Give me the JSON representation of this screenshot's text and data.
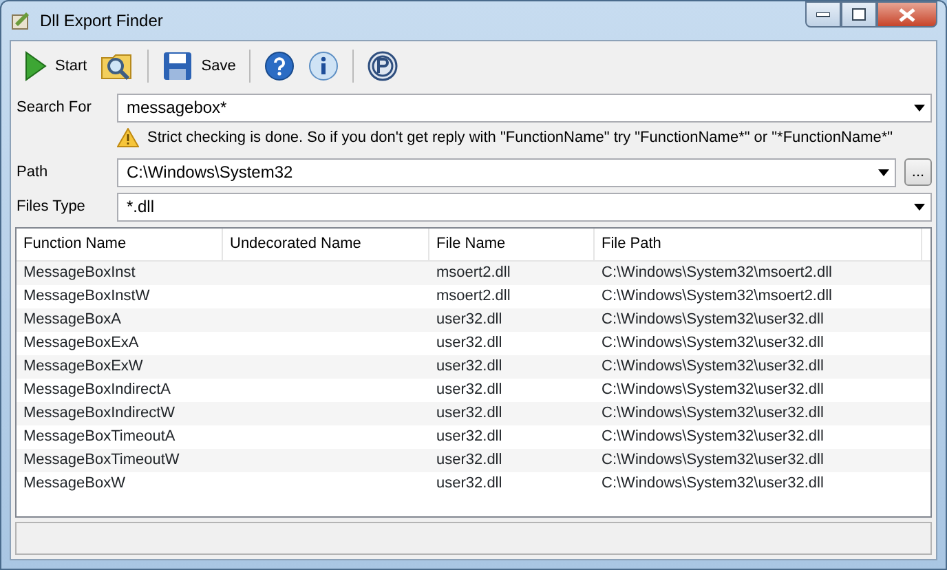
{
  "window": {
    "title": "Dll Export Finder"
  },
  "toolbar": [
    {
      "kind": "start",
      "label": "Start"
    },
    {
      "kind": "browse"
    },
    {
      "kind": "sep"
    },
    {
      "kind": "save",
      "label": "Save"
    },
    {
      "kind": "sep"
    },
    {
      "kind": "help"
    },
    {
      "kind": "info"
    },
    {
      "kind": "sep"
    },
    {
      "kind": "donate"
    }
  ],
  "search": {
    "label": "Search For",
    "value": "messagebox*"
  },
  "hint": "Strict checking is done. So if you don't get reply with \"FunctionName\" try \"FunctionName*\" or \"*FunctionName*\"",
  "path": {
    "label": "Path",
    "value": "C:\\Windows\\System32",
    "browse": "..."
  },
  "files_type": {
    "label": "Files Type",
    "value": "*.dll"
  },
  "table": {
    "columns": [
      "Function Name",
      "Undecorated Name",
      "File Name",
      "File Path"
    ],
    "rows": [
      [
        "MessageBoxInst",
        "",
        "msoert2.dll",
        "C:\\Windows\\System32\\msoert2.dll"
      ],
      [
        "MessageBoxInstW",
        "",
        "msoert2.dll",
        "C:\\Windows\\System32\\msoert2.dll"
      ],
      [
        "MessageBoxA",
        "",
        "user32.dll",
        "C:\\Windows\\System32\\user32.dll"
      ],
      [
        "MessageBoxExA",
        "",
        "user32.dll",
        "C:\\Windows\\System32\\user32.dll"
      ],
      [
        "MessageBoxExW",
        "",
        "user32.dll",
        "C:\\Windows\\System32\\user32.dll"
      ],
      [
        "MessageBoxIndirectA",
        "",
        "user32.dll",
        "C:\\Windows\\System32\\user32.dll"
      ],
      [
        "MessageBoxIndirectW",
        "",
        "user32.dll",
        "C:\\Windows\\System32\\user32.dll"
      ],
      [
        "MessageBoxTimeoutA",
        "",
        "user32.dll",
        "C:\\Windows\\System32\\user32.dll"
      ],
      [
        "MessageBoxTimeoutW",
        "",
        "user32.dll",
        "C:\\Windows\\System32\\user32.dll"
      ],
      [
        "MessageBoxW",
        "",
        "user32.dll",
        "C:\\Windows\\System32\\user32.dll"
      ]
    ]
  }
}
